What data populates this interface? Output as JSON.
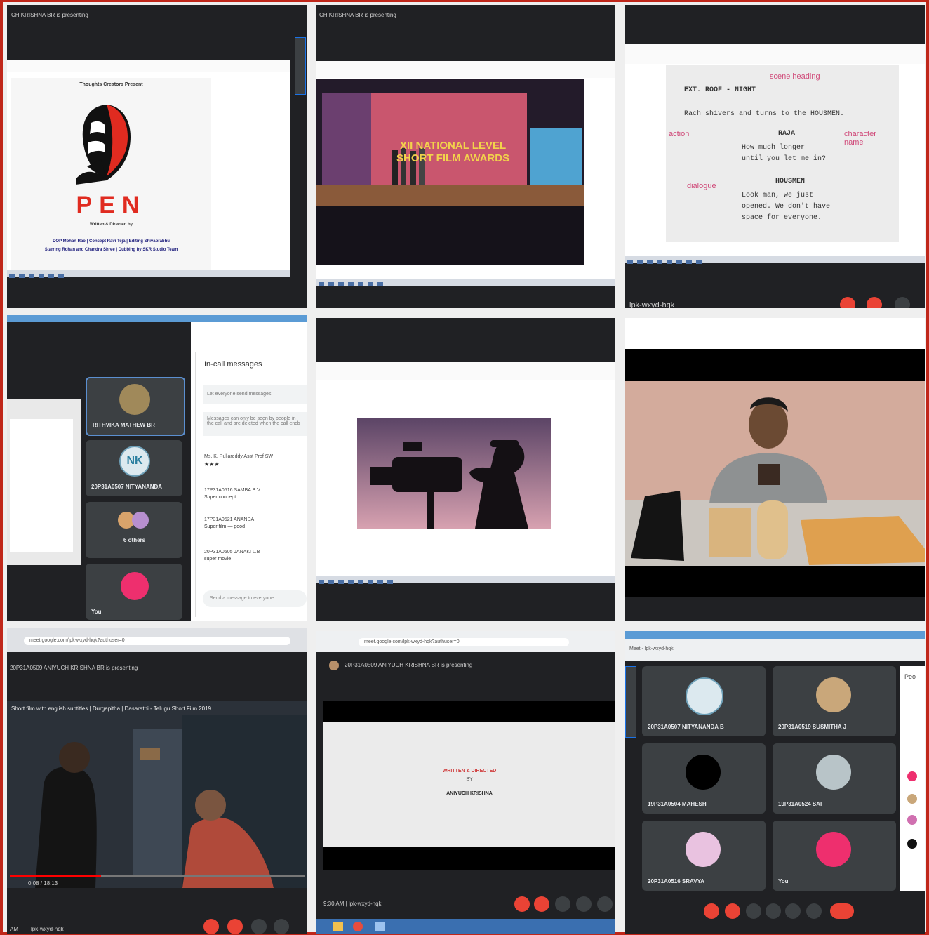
{
  "panels": {
    "p1": {
      "presenting": "CH KRISHNA BR is presenting",
      "slide_small_title": "Thoughts Creators Present",
      "logo_text": "PEN",
      "written_directed": "Written & Directed by",
      "credits_line1": "DOP Mohan Rao | Concept Ravi Teja | Editing Shivaprabhu",
      "credits_line2": "Starring Rohan and Chandra Shree | Dubbing by SKR Studio Team"
    },
    "p2": {
      "presenting": "CH KRISHNA BR is presenting",
      "banner_line1": "XII NATIONAL LEVEL",
      "banner_line2": "SHORT FILM AWARDS"
    },
    "p3": {
      "line_header": "EXT. ROOF - NIGHT",
      "note_scene": "scene heading",
      "line_action": "Rach shivers and turns to the HOUSMEN.",
      "note_action": "action",
      "char1": "RAJA",
      "note_char": "character name",
      "dialog1a": "How much longer",
      "dialog1b": "until you let me in?",
      "note_dialog": "dialogue",
      "char2": "HOUSMEN",
      "dialog2a": "Look man, we just",
      "dialog2b": "opened. We don't have",
      "dialog2c": "space for everyone.",
      "status": "lpk-wxyd-hqk"
    },
    "p4": {
      "chat_title": "In-call messages",
      "chat_toggle": "Let everyone send messages",
      "chat_note": "Messages can only be seen by people in the call and are deleted when the call ends",
      "msg1_sender": "Ms. K. Pullareddy Asst Prof SW",
      "msg1_text": "★★★",
      "msg2_sender": "17P31A0516 SAMBA B V",
      "msg2_text": "Super concept",
      "msg3_sender": "17P31A0521 ANANDA",
      "msg3_text": "Super film — good",
      "msg4_sender": "20P31A0505 JANAKI L.B",
      "msg4_text": "super movie",
      "chat_input": "Send a message to everyone",
      "tile1": "RITHVIKA MATHEW BR",
      "tile2": "20P31A0507 NITYANANDA",
      "tile3": "6 others",
      "tile4": "You",
      "nk_initials": "NK"
    },
    "p7": {
      "presenting": "20P31A0509 ANIYUCH KRISHNA BR is presenting",
      "url": "meet.google.com/lpk-wxyd-hqk?authuser=0",
      "video_title": "Short film with english subtitles | Durgapitha | Dasarathi - Telugu Short Film 2019",
      "time": "0:08 / 18:13",
      "clock": "AM",
      "meeting": "lpk-wxyd-hqk"
    },
    "p8": {
      "url": "meet.google.com/lpk-wxyd-hqk?authuser=0",
      "presenting": "20P31A0509 ANIYUCH KRISHNA BR is presenting",
      "credit_line1": "WRITTEN & DIRECTED",
      "credit_line2": "BY",
      "credit_line3": "ANIYUCH KRISHNA",
      "time_meeting": "9:30 AM | lpk-wxyd-hqk"
    },
    "p9": {
      "tab": "Meet - lpk-wxyd-hqk",
      "tiles": [
        {
          "label": "20P31A0507 NITYANANDA B",
          "kind": "NK"
        },
        {
          "label": "20P31A0519 SUSMITHA J",
          "kind": "photo"
        },
        {
          "label": "19P31A0504 MAHESH",
          "kind": "I"
        },
        {
          "label": "19P31A0524 SAI",
          "kind": "scene"
        },
        {
          "label": "20P31A0516 SRAVYA",
          "kind": "girl"
        },
        {
          "label": "You",
          "kind": "pink"
        }
      ],
      "side_label": "Peo"
    }
  },
  "colors": {
    "border": "#c0271a",
    "meet_dark": "#202124",
    "tile": "#3c4043",
    "end_call": "#ea4335",
    "pen_red": "#e02b20",
    "accent_blue": "#1a73e8"
  }
}
